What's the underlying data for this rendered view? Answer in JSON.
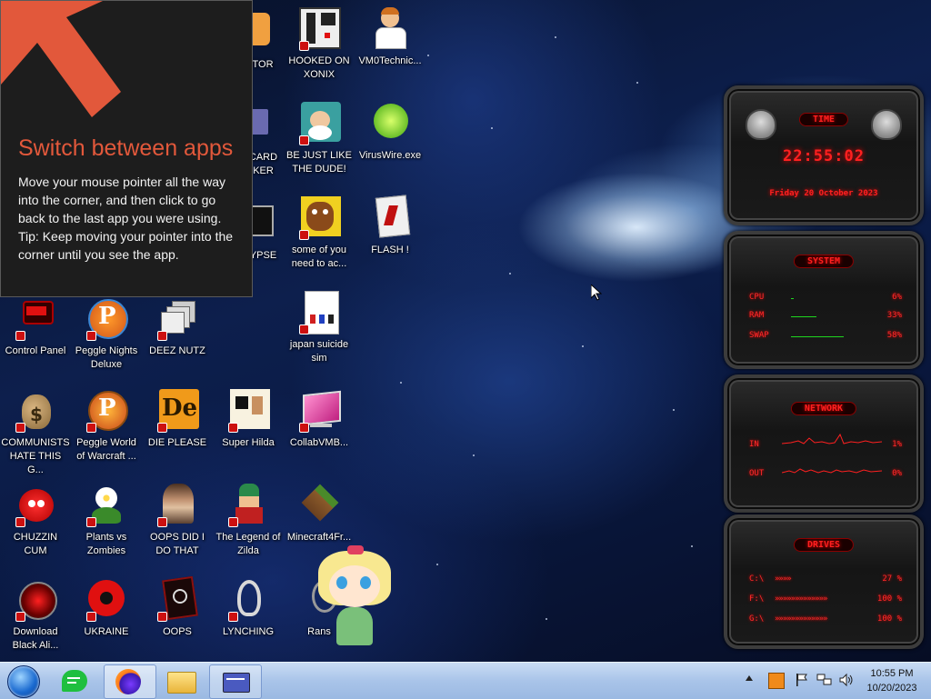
{
  "corner_tip": {
    "title": "Switch between apps",
    "body1": "Move your mouse pointer all the way into the corner, and then click to go back to the last app you were using.",
    "body2": "Tip: Keep moving your pointer into the corner until you see the app."
  },
  "desktop_icons": {
    "c0": [
      {
        "label": "Control Panel"
      },
      {
        "label": "COMMUNISTS HATE THIS G..."
      },
      {
        "label": "CHUZZIN CUM"
      },
      {
        "label": "Download Black Ali..."
      }
    ],
    "c1": [
      {
        "label": "Peggle Nights Deluxe"
      },
      {
        "label": "Peggle World of Warcraft ..."
      },
      {
        "label": "Plants vs Zombies"
      },
      {
        "label": "UKRAINE"
      }
    ],
    "c2": [
      {
        "label": "DEEZ NUTZ"
      },
      {
        "label": "DIE PLEASE"
      },
      {
        "label": "OOPS DID I DO THAT"
      },
      {
        "label": "OOPS"
      }
    ],
    "c3": [
      {
        "label": "ITOR"
      },
      {
        "label": "CARD KER"
      },
      {
        "label": "YPSE"
      },
      {
        "label": "Super Hilda"
      },
      {
        "label": "The Legend of Zilda"
      },
      {
        "label": "LYNCHING"
      }
    ],
    "c4": [
      {
        "label": "HOOKED ON XONIX"
      },
      {
        "label": "BE JUST LIKE THE DUDE!"
      },
      {
        "label": "some of you need to ac..."
      },
      {
        "label": "japan suicide sim"
      },
      {
        "label": "CollabVMB..."
      },
      {
        "label": "Minecraft4Fr..."
      },
      {
        "label": "Rans"
      }
    ],
    "c5": [
      {
        "label": "VM0Technic..."
      },
      {
        "label": "VirusWire.exe"
      },
      {
        "label": "FLASH !"
      }
    ]
  },
  "widgets": {
    "time": {
      "title": "TIME",
      "clock": "22:55:02",
      "date": "Friday 20 October 2023"
    },
    "system": {
      "title": "SYSTEM",
      "rows": [
        {
          "label": "CPU",
          "value": "6%",
          "level": 0.06
        },
        {
          "label": "RAM",
          "value": "33%",
          "level": 0.33
        },
        {
          "label": "SWAP",
          "value": "58%",
          "level": 0.58
        }
      ]
    },
    "network": {
      "title": "NETWORK",
      "rows": [
        {
          "label": "IN",
          "value": "1%"
        },
        {
          "label": "OUT",
          "value": "0%"
        }
      ]
    },
    "drives": {
      "title": "DRIVES",
      "rows": [
        {
          "label": "C:\\",
          "value": "27 %"
        },
        {
          "label": "F:\\",
          "value": "100 %"
        },
        {
          "label": "G:\\",
          "value": "100 %"
        }
      ]
    }
  },
  "taskbar": {
    "clock_time": "10:55 PM",
    "clock_date": "10/20/2023",
    "apps": [
      "start",
      "greenchat",
      "firefox",
      "file-explorer",
      "cardapp"
    ]
  },
  "colors": {
    "accent": "#e2583b",
    "widget_red": "#ff2020",
    "widget_green": "#1fd61f"
  }
}
